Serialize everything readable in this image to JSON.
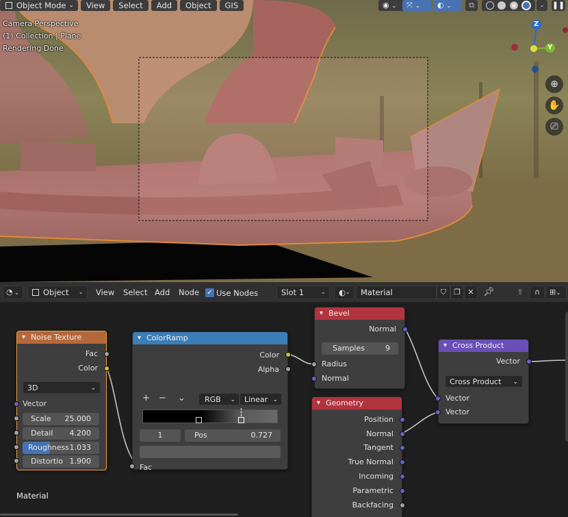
{
  "viewport": {
    "mode_label": "Object Mode",
    "menus": [
      "View",
      "Select",
      "Add",
      "Object",
      "GIS"
    ],
    "info": [
      "Camera Perspective",
      "(1) Collection | Plane",
      "Rendering Done"
    ],
    "gizmo_axes": {
      "z": "Z",
      "y": "Y"
    }
  },
  "node_editor": {
    "editor_type_label": "Object",
    "menus": [
      "View",
      "Select",
      "Add",
      "Node"
    ],
    "use_nodes_label": "Use Nodes",
    "use_nodes_checked": true,
    "slot_label": "Slot 1",
    "material_name": "Material",
    "footer_label": "Material",
    "nodes": {
      "noise": {
        "title": "Noise Texture",
        "outputs": [
          "Fac",
          "Color"
        ],
        "dimensions": "3D",
        "vector_label": "Vector",
        "fields": [
          {
            "name": "Scale",
            "value": "25.000"
          },
          {
            "name": "Detail",
            "value": "4.200"
          },
          {
            "name": "Roughness",
            "value": "1.033"
          },
          {
            "name": "Distortio",
            "value": "1.900"
          }
        ]
      },
      "colorramp": {
        "title": "ColorRamp",
        "outputs": [
          "Color",
          "Alpha"
        ],
        "add_label": "+",
        "remove_label": "−",
        "more_label": "⌄",
        "color_mode": "RGB",
        "interpolation": "Linear",
        "stop_index": "1",
        "pos_label": "Pos",
        "pos_value": "0.727",
        "input_label": "Fac"
      },
      "bevel": {
        "title": "Bevel",
        "output": "Normal",
        "samples_label": "Samples",
        "samples_value": "9",
        "inputs": [
          "Radius",
          "Normal"
        ]
      },
      "geometry": {
        "title": "Geometry",
        "outputs": [
          "Position",
          "Normal",
          "Tangent",
          "True Normal",
          "Incoming",
          "Parametric",
          "Backfacing"
        ]
      },
      "cross": {
        "title": "Cross Product",
        "output": "Vector",
        "operation": "Cross Product",
        "inputs": [
          "Vector",
          "Vector"
        ]
      }
    }
  },
  "colors": {
    "selection_outline": "#f0a040",
    "socket_float": "#a1a1a1",
    "socket_color": "#c7c729",
    "socket_vector": "#6363c7",
    "header_texture": "#b5683a",
    "header_converter": "#3b7eb8",
    "header_input": "#b2343f",
    "header_vector": "#6a4fb8",
    "active_field": "#4772b3"
  },
  "roughness_fill_fraction": 0.36
}
